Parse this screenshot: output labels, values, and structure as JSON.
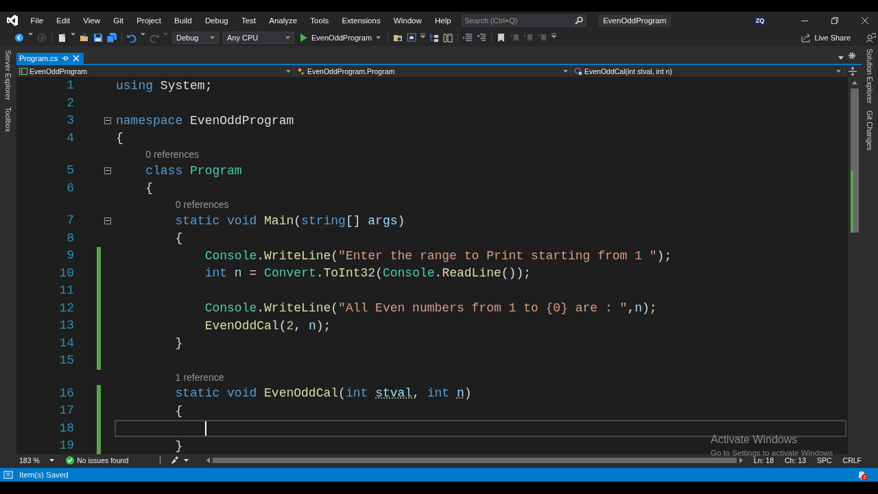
{
  "menu_bar": {
    "items": [
      "File",
      "Edit",
      "View",
      "Git",
      "Project",
      "Build",
      "Debug",
      "Test",
      "Analyze",
      "Tools",
      "Extensions",
      "Window",
      "Help"
    ],
    "search": {
      "placeholder": "Search (Ctrl+Q)"
    },
    "solution_title": "EvenOddProgram",
    "avatar": "ZQ"
  },
  "toolbar": {
    "configuration": "Debug",
    "platform": "Any CPU",
    "start_target": "EvenOddProgram",
    "live_share": "Live Share"
  },
  "left_strip": [
    "Server Explorer",
    "Toolbox"
  ],
  "right_strip": [
    "Solution Explorer",
    "Git Changes"
  ],
  "tabs": [
    {
      "label": "Program.cs",
      "selected": true
    }
  ],
  "navigation": [
    "EvenOddProgram",
    "EvenOddProgram.Program",
    "EvenOddCal(int stval, int n)"
  ],
  "editor": {
    "lines": [
      {
        "kind": "code",
        "number": "1",
        "foldable": false,
        "changed": false,
        "current": false,
        "tokens": [
          {
            "text": "using",
            "kind": "keyword"
          },
          {
            "text": " System;",
            "kind": "plain"
          }
        ]
      },
      {
        "kind": "code",
        "number": "2",
        "foldable": false,
        "changed": false,
        "current": false
      },
      {
        "kind": "code",
        "number": "3",
        "foldable": true,
        "changed": false,
        "current": false,
        "tokens": [
          {
            "text": "namespace",
            "kind": "keyword"
          },
          {
            "text": " EvenOddProgram",
            "kind": "plain"
          }
        ]
      },
      {
        "kind": "code",
        "number": "4",
        "foldable": false,
        "changed": false,
        "current": false,
        "tokens": [
          {
            "text": "{",
            "kind": "plain"
          }
        ]
      },
      {
        "kind": "lens",
        "text": "0 references"
      },
      {
        "kind": "code",
        "number": "5",
        "foldable": true,
        "changed": false,
        "current": false,
        "tokens": [
          {
            "text": "    class",
            "kind": "keyword"
          },
          {
            "text": " Program",
            "kind": "type"
          }
        ]
      },
      {
        "kind": "code",
        "number": "6",
        "foldable": false,
        "changed": false,
        "current": false,
        "tokens": [
          {
            "text": "    {",
            "kind": "plain"
          }
        ]
      },
      {
        "kind": "lens",
        "text": "0 references"
      },
      {
        "kind": "code",
        "number": "7",
        "foldable": true,
        "changed": false,
        "current": false,
        "tokens": [
          {
            "text": "        static void",
            "kind": "keyword"
          },
          {
            "text": " Main",
            "kind": "method"
          },
          {
            "text": "(",
            "kind": "plain"
          },
          {
            "text": "string",
            "kind": "keyword"
          },
          {
            "text": "[] ",
            "kind": "plain"
          },
          {
            "text": "args",
            "kind": "local"
          },
          {
            "text": ")",
            "kind": "plain"
          }
        ]
      },
      {
        "kind": "code",
        "number": "8",
        "foldable": false,
        "changed": false,
        "current": false,
        "tokens": [
          {
            "text": "        {",
            "kind": "plain"
          }
        ]
      },
      {
        "kind": "code",
        "number": "9",
        "foldable": false,
        "changed": true,
        "current": false,
        "tokens": [
          {
            "text": "            Console",
            "kind": "type"
          },
          {
            "text": ".",
            "kind": "plain"
          },
          {
            "text": "WriteLine",
            "kind": "method"
          },
          {
            "text": "(",
            "kind": "plain"
          },
          {
            "text": "\"Enter the range to Print starting from 1 \"",
            "kind": "string"
          },
          {
            "text": ");",
            "kind": "plain"
          }
        ]
      },
      {
        "kind": "code",
        "number": "10",
        "foldable": false,
        "changed": true,
        "current": false,
        "tokens": [
          {
            "text": "            int",
            "kind": "keyword"
          },
          {
            "text": " n",
            "kind": "local"
          },
          {
            "text": " = ",
            "kind": "plain"
          },
          {
            "text": "Convert",
            "kind": "type"
          },
          {
            "text": ".",
            "kind": "plain"
          },
          {
            "text": "ToInt32",
            "kind": "method"
          },
          {
            "text": "(",
            "kind": "plain"
          },
          {
            "text": "Console",
            "kind": "type"
          },
          {
            "text": ".",
            "kind": "plain"
          },
          {
            "text": "ReadLine",
            "kind": "method"
          },
          {
            "text": "());",
            "kind": "plain"
          }
        ]
      },
      {
        "kind": "code",
        "number": "11",
        "foldable": false,
        "changed": true,
        "current": false
      },
      {
        "kind": "code",
        "number": "12",
        "foldable": false,
        "changed": true,
        "current": false,
        "tokens": [
          {
            "text": "            Console",
            "kind": "type"
          },
          {
            "text": ".",
            "kind": "plain"
          },
          {
            "text": "WriteLine",
            "kind": "method"
          },
          {
            "text": "(",
            "kind": "plain"
          },
          {
            "text": "\"All Even numbers from 1 to {0} are : \"",
            "kind": "string"
          },
          {
            "text": ",",
            "kind": "plain"
          },
          {
            "text": "n",
            "kind": "local"
          },
          {
            "text": ");",
            "kind": "plain"
          }
        ]
      },
      {
        "kind": "code",
        "number": "13",
        "foldable": false,
        "changed": true,
        "current": false,
        "tokens": [
          {
            "text": "            EvenOddCal",
            "kind": "method"
          },
          {
            "text": "(",
            "kind": "plain"
          },
          {
            "text": "2",
            "kind": "number"
          },
          {
            "text": ", ",
            "kind": "plain"
          },
          {
            "text": "n",
            "kind": "local"
          },
          {
            "text": ");",
            "kind": "plain"
          }
        ]
      },
      {
        "kind": "code",
        "number": "14",
        "foldable": false,
        "changed": true,
        "current": false,
        "tokens": [
          {
            "text": "        }",
            "kind": "plain"
          }
        ]
      },
      {
        "kind": "code",
        "number": "15",
        "foldable": false,
        "changed": true,
        "current": false
      },
      {
        "kind": "lens",
        "text": "1 reference"
      },
      {
        "kind": "code",
        "number": "16",
        "foldable": false,
        "changed": true,
        "current": false,
        "tokens": [
          {
            "text": "        static void",
            "kind": "keyword"
          },
          {
            "text": " EvenOddCal",
            "kind": "method"
          },
          {
            "text": "(",
            "kind": "plain"
          },
          {
            "text": "int",
            "kind": "keyword"
          },
          {
            "text": " stval",
            "kind": "unused"
          },
          {
            "text": ", ",
            "kind": "plain"
          },
          {
            "text": "int",
            "kind": "keyword"
          },
          {
            "text": " n",
            "kind": "unused"
          },
          {
            "text": ")",
            "kind": "plain"
          }
        ]
      },
      {
        "kind": "code",
        "number": "17",
        "foldable": false,
        "changed": true,
        "current": false,
        "tokens": [
          {
            "text": "        {",
            "kind": "plain"
          }
        ]
      },
      {
        "kind": "code",
        "number": "18",
        "foldable": false,
        "changed": true,
        "current": true
      },
      {
        "kind": "code",
        "number": "19",
        "foldable": false,
        "changed": true,
        "current": false,
        "tokens": [
          {
            "text": "        }",
            "kind": "plain"
          }
        ]
      }
    ],
    "zoom": "183 %",
    "issues": "No issues found",
    "line": "Ln: 18",
    "column": "Ch: 13",
    "whitespace": "SPC",
    "line_ending": "CRLF"
  },
  "activation_notice": {
    "title": "Activate Windows",
    "subtitle": "Go to Settings to activate Windows"
  },
  "status_bar": {
    "message": "Item(s) Saved",
    "notifications": "2"
  }
}
